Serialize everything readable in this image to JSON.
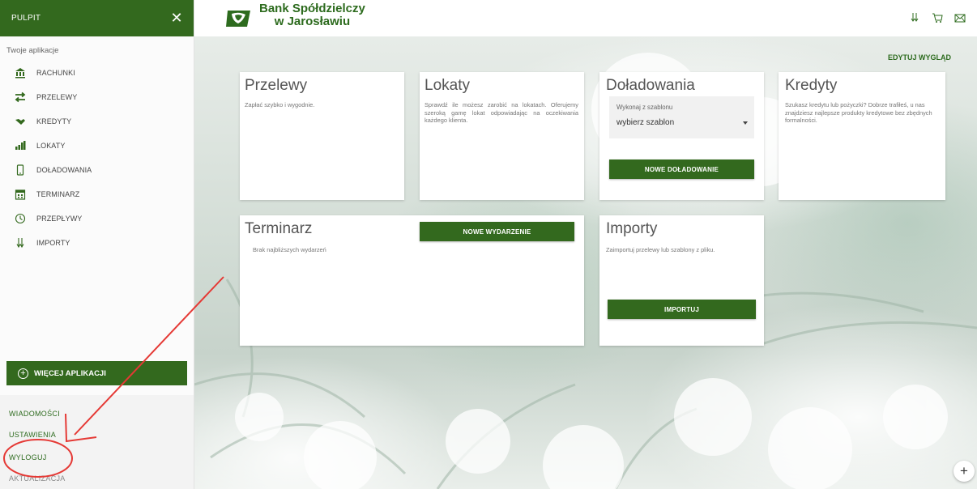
{
  "header": {
    "brand_line1": "Bank Spółdzielczy",
    "brand_line2": "w Jarosławiu"
  },
  "sidebar": {
    "title": "PULPIT",
    "close_icon": "close-icon",
    "apps_label": "Twoje aplikacje",
    "items": [
      {
        "label": "RACHUNKI",
        "icon": "bank-icon"
      },
      {
        "label": "PRZELEWY",
        "icon": "transfer-icon"
      },
      {
        "label": "KREDYTY",
        "icon": "handshake-icon"
      },
      {
        "label": "LOKATY",
        "icon": "bars-icon"
      },
      {
        "label": "DOŁADOWANIA",
        "icon": "phone-icon"
      },
      {
        "label": "TERMINARZ",
        "icon": "calendar-icon"
      },
      {
        "label": "PRZEPŁYWY",
        "icon": "flow-icon"
      },
      {
        "label": "IMPORTY",
        "icon": "import-icon"
      }
    ],
    "more_apps": "WIĘCEJ APLIKACJI",
    "bottom_links": [
      "WIADOMOŚCI",
      "USTAWIENIA",
      "WYLOGUJ",
      "AKTUALIZACJA"
    ]
  },
  "main": {
    "edit_layout": "EDYTUJ WYGLĄD",
    "cards": {
      "przelewy": {
        "title": "Przelewy",
        "text": "Zapłać szybko i wygodnie."
      },
      "lokaty": {
        "title": "Lokaty",
        "text": "Sprawdź ile możesz zarobić na lokatach. Oferujemy szeroką gamę lokat odpowiadając na oczekiwania każdego klienta."
      },
      "doladowania": {
        "title": "Doładowania",
        "select_label": "Wykonaj z szablonu",
        "select_value": "wybierz szablon",
        "button": "NOWE DOŁADOWANIE"
      },
      "kredyty": {
        "title": "Kredyty",
        "text": "Szukasz kredytu lub pożyczki? Dobrze trafiłeś, u nas znajdziesz najlepsze produkty kredytowe bez zbędnych formalności."
      },
      "terminarz": {
        "title": "Terminarz",
        "text": "Brak najbliższych wydarzeń",
        "button": "NOWE WYDARZENIE"
      },
      "importy": {
        "title": "Importy",
        "text": "Zaimportuj przelewy lub szablony z pliku.",
        "button": "IMPORTUJ"
      }
    }
  },
  "fab_label": "+",
  "colors": {
    "brand": "#33691e",
    "annotation": "#e53935"
  }
}
